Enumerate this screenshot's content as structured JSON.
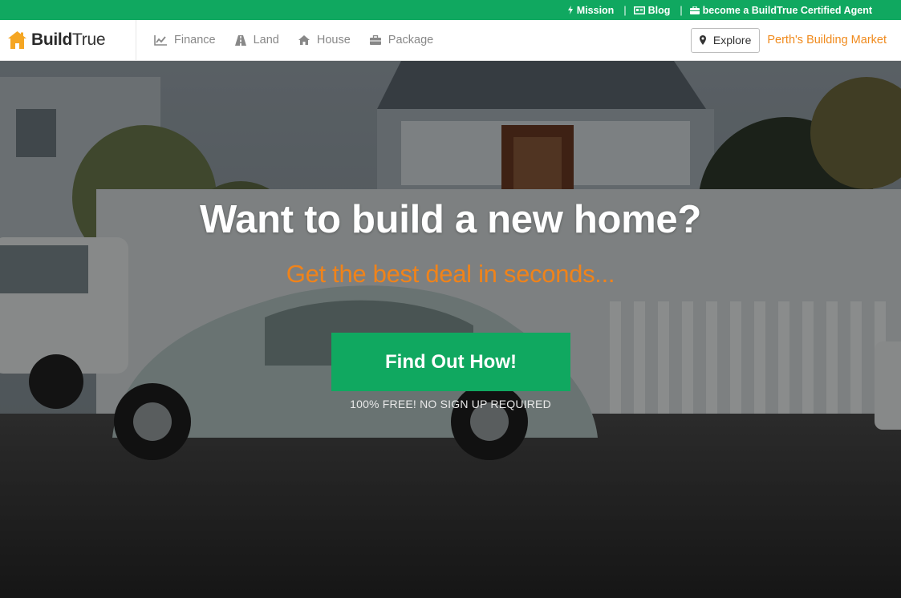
{
  "topbar": {
    "mission_label": "Mission",
    "separator": "|",
    "blog_label": "Blog",
    "agent_label": "become a BuildTrue Certified Agent",
    "bg_color": "#10a860"
  },
  "brand": {
    "name_bold": "Build",
    "name_regular": "True",
    "logo_color": "#f5a623"
  },
  "nav": {
    "items": [
      {
        "label": "Finance",
        "icon": "chart-line-icon"
      },
      {
        "label": "Land",
        "icon": "road-icon"
      },
      {
        "label": "House",
        "icon": "home-icon"
      },
      {
        "label": "Package",
        "icon": "briefcase-icon"
      }
    ],
    "explore_label": "Explore",
    "market_label": "Perth's Building Market",
    "market_color": "#f08a1c"
  },
  "hero": {
    "title": "Want to build a new home?",
    "subtitle": "Get the best deal in seconds...",
    "cta_label": "Find Out How!",
    "note": "100% FREE! NO SIGN UP REQUIRED",
    "accent_color": "#10a860",
    "subtitle_color": "#f0831a"
  }
}
